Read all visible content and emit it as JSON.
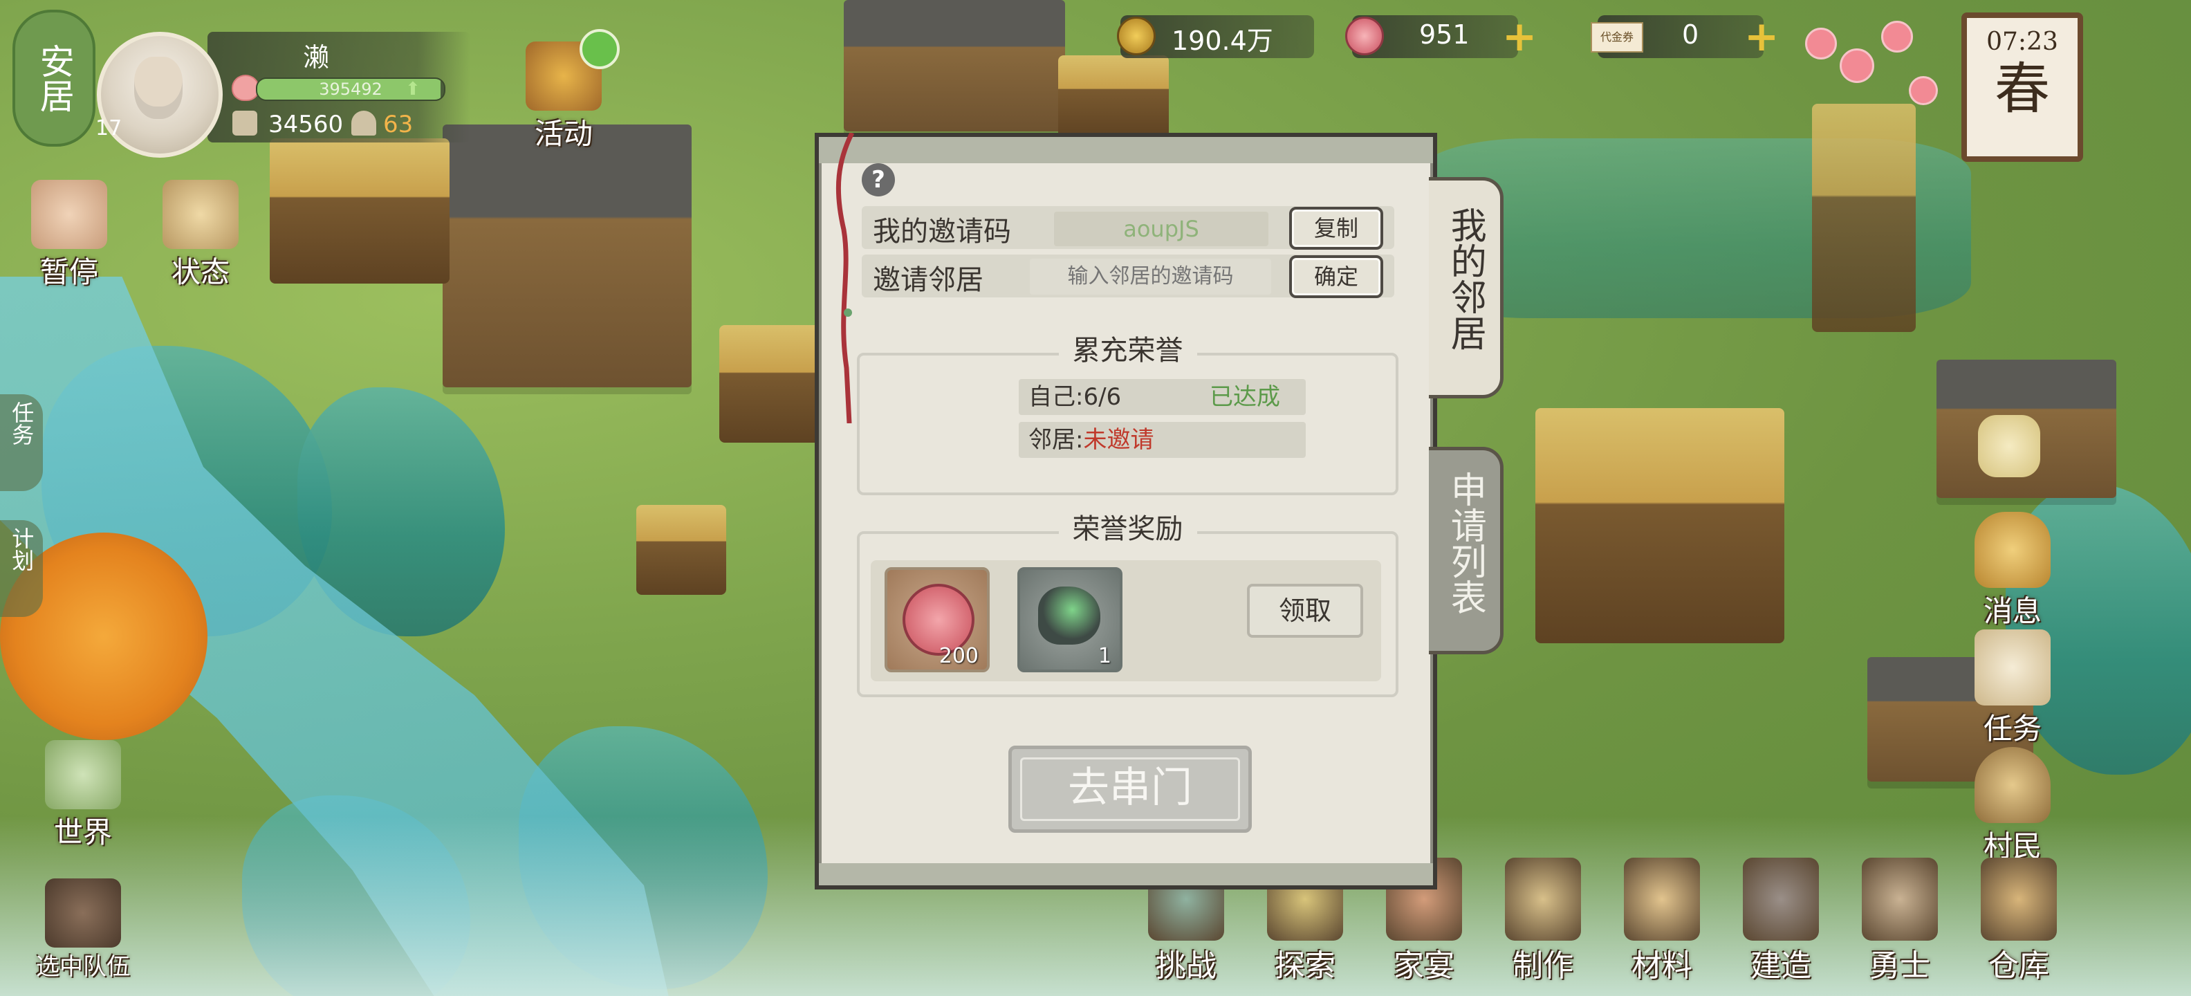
{
  "hud": {
    "status_label": "安居",
    "player_level": "17",
    "player_name": "濑",
    "exp_value": "395492",
    "exp_fraction": 0.98,
    "stat_building": "34560",
    "stat_people": "63",
    "activity_label": "活动"
  },
  "resources": {
    "coins": "190.4万",
    "blossom": "951",
    "voucher_icon_text": "代金券",
    "voucher": "0"
  },
  "clock": {
    "time": "07:23",
    "season": "春"
  },
  "left_menu": {
    "pause": "暂停",
    "status": "状态",
    "task_tab": "任务",
    "plan_tab": "计划",
    "world": "世界",
    "team": "选中队伍"
  },
  "dialog": {
    "help": "?",
    "my_code_label": "我的邀请码",
    "my_code_value": "aoupJS",
    "copy_button": "复制",
    "invite_label": "邀请邻居",
    "invite_placeholder": "输入邻居的邀请码",
    "confirm_button": "确定",
    "honor_title": "累充荣誉",
    "self_label": "自己:6/6",
    "self_status": "已达成",
    "neighbor_label": "邻居:",
    "neighbor_status": "未邀请",
    "reward_title": "荣誉奖励",
    "reward_items": [
      {
        "name": "blossom",
        "count": "200"
      },
      {
        "name": "jade-ore",
        "count": "1"
      }
    ],
    "claim_button": "领取",
    "go_button": "去串门",
    "tab_my_neighbors": "我的邻居",
    "tab_requests": "申请列表"
  },
  "right_menu": {
    "messages": "消息",
    "tasks": "任务",
    "villagers": "村民"
  },
  "bottom_menu": [
    "挑战",
    "探索",
    "家宴",
    "制作",
    "材料",
    "建造",
    "勇士",
    "仓库"
  ],
  "colors": {
    "accent_green": "#8dc76a",
    "gold": "#e7c23a",
    "achieved_green": "#5c9a4a",
    "not_invited_red": "#c0392b"
  }
}
